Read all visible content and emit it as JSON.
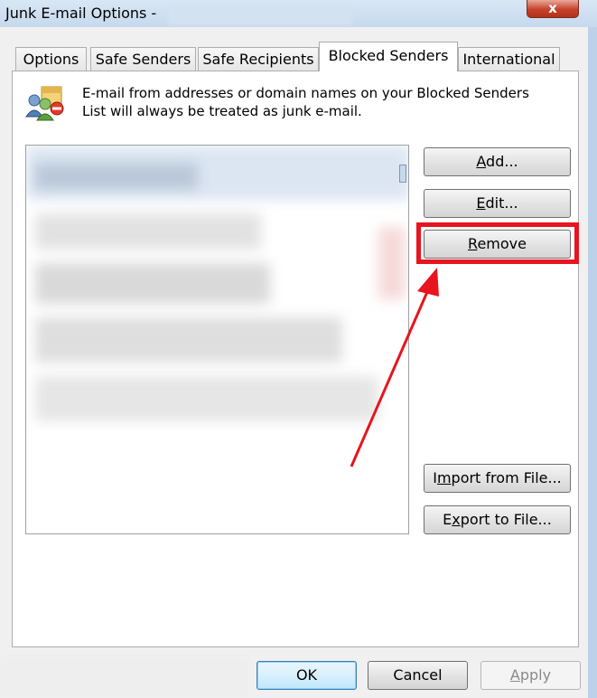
{
  "window": {
    "title": "Junk E-mail Options -",
    "close_label": "x"
  },
  "tabs": [
    {
      "label": "Options",
      "active": false
    },
    {
      "label": "Safe Senders",
      "active": false
    },
    {
      "label": "Safe Recipients",
      "active": false
    },
    {
      "label": "Blocked Senders",
      "active": true
    },
    {
      "label": "International",
      "active": false
    }
  ],
  "info": {
    "icon": "blocked-senders-icon",
    "line1": "E-mail from addresses or domain names on your Blocked Senders",
    "line2": "List will always be treated as junk e-mail."
  },
  "side_buttons": {
    "add": {
      "pre": "",
      "mnemonic": "A",
      "post": "dd..."
    },
    "edit": {
      "pre": "",
      "mnemonic": "E",
      "post": "dit..."
    },
    "remove": {
      "pre": "",
      "mnemonic": "R",
      "post": "emove"
    },
    "import": {
      "pre": "I",
      "mnemonic": "m",
      "post": "port from File..."
    },
    "export": {
      "pre": "E",
      "mnemonic": "x",
      "post": "port to File..."
    }
  },
  "footer": {
    "ok": "OK",
    "cancel": "Cancel",
    "apply": {
      "pre": "",
      "mnemonic": "A",
      "post": "pply"
    }
  },
  "annotation": {
    "highlight_color": "#e8141f",
    "arrow_color": "#e8141f"
  },
  "colors": {
    "title_bar": "#c3d7ec",
    "close_button": "#c6412b",
    "ok_button_border": "#3c7fb1"
  }
}
